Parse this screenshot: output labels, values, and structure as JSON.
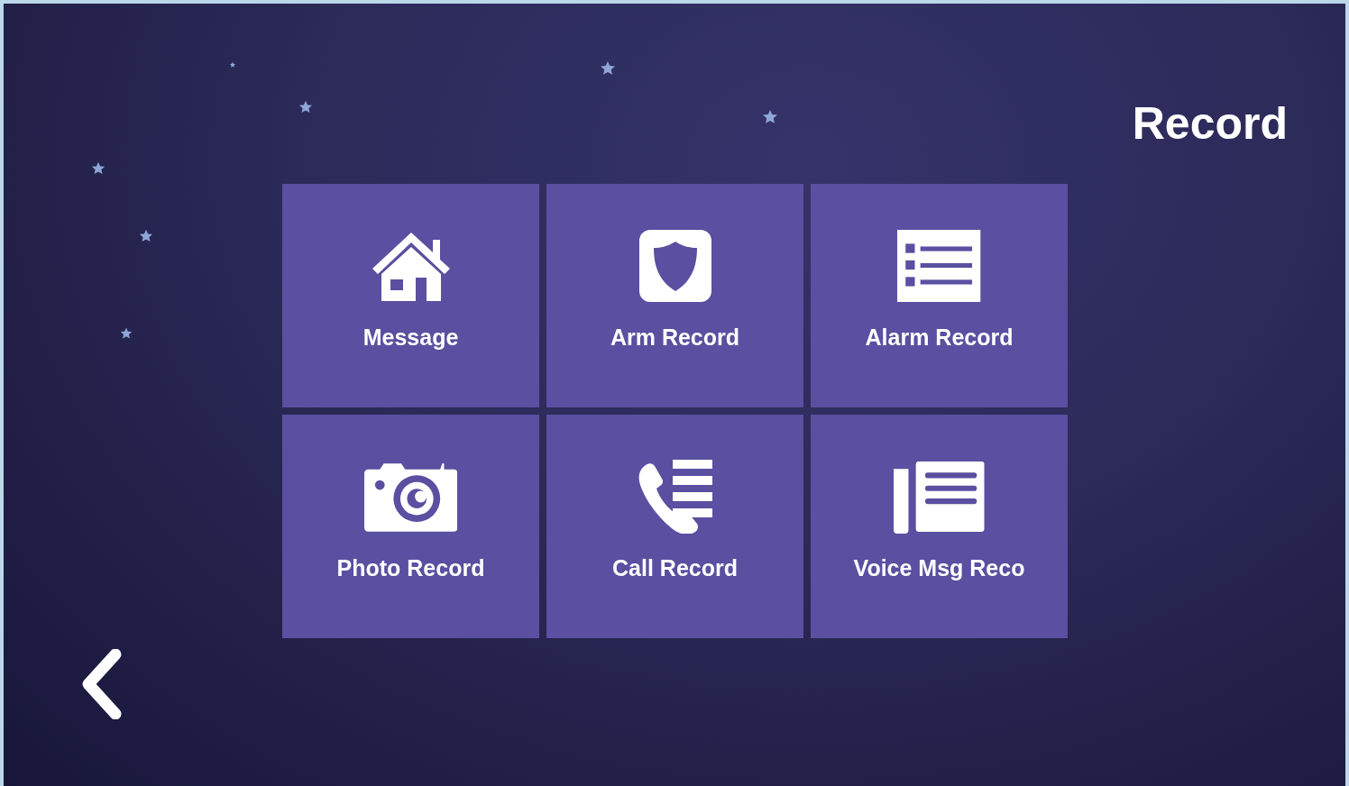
{
  "title": "Record",
  "tiles": [
    {
      "label": "Message",
      "kind": "house"
    },
    {
      "label": "Arm Record",
      "kind": "shield"
    },
    {
      "label": "Alarm Record",
      "kind": "list"
    },
    {
      "label": "Photo Record",
      "kind": "camera"
    },
    {
      "label": "Call Record",
      "kind": "phone"
    },
    {
      "label": "Voice Msg Reco",
      "kind": "voice"
    }
  ]
}
